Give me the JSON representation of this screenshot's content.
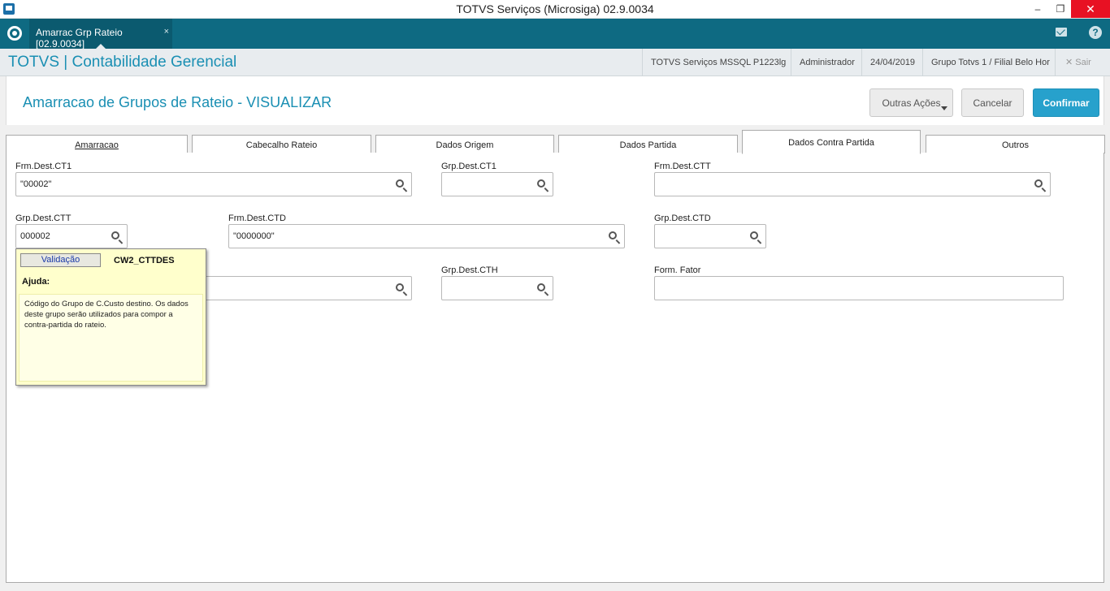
{
  "window": {
    "title": "TOTVS Serviços (Microsiga) 02.9.0034",
    "minimize": "–",
    "maximize": "❐",
    "close": "✕"
  },
  "tabstrip": {
    "doc_tab_label": "Amarrac Grp Rateio [02.9.0034]",
    "doc_tab_close": "×",
    "help": "?"
  },
  "header": {
    "brand": "TOTVS | Contabilidade Gerencial",
    "server": "TOTVS Serviços MSSQL P1223lg",
    "user": "Administrador",
    "date": "24/04/2019",
    "company": "Grupo Totvs 1 / Filial Belo Hor",
    "logout": "✕  Sair"
  },
  "page": {
    "title": "Amarracao de Grupos de Rateio - VISUALIZAR",
    "other_actions": "Outras Ações",
    "cancel": "Cancelar",
    "confirm": "Confirmar"
  },
  "tabs": [
    {
      "label": "Amarracao"
    },
    {
      "label": "Cabecalho Rateio"
    },
    {
      "label": "Dados Origem"
    },
    {
      "label": "Dados Partida"
    },
    {
      "label": "Dados Contra Partida"
    },
    {
      "label": "Outros"
    }
  ],
  "fields": {
    "frm_dest_ct1": {
      "label": "Frm.Dest.CT1",
      "value": "\"00002\""
    },
    "grp_dest_ct1": {
      "label": "Grp.Dest.CT1",
      "value": ""
    },
    "frm_dest_ctt": {
      "label": "Frm.Dest.CTT",
      "value": ""
    },
    "grp_dest_ctt": {
      "label": "Grp.Dest.CTT",
      "value": "000002"
    },
    "frm_dest_ctd": {
      "label": "Frm.Dest.CTD",
      "value": "\"0000000\""
    },
    "grp_dest_ctd": {
      "label": "Grp.Dest.CTD",
      "value": ""
    },
    "frm_dest_cth": {
      "value": ""
    },
    "grp_dest_cth": {
      "label": "Grp.Dest.CTH",
      "value": ""
    },
    "form_fator": {
      "label": "Form. Fator",
      "value": ""
    }
  },
  "help": {
    "validation_button": "Validação",
    "field_code": "CW2_CTTDES",
    "heading": "Ajuda:",
    "text": "Código do Grupo de C.Custo destino. Os dados deste grupo serão utilizados para compor a contra-partida do rateio."
  }
}
